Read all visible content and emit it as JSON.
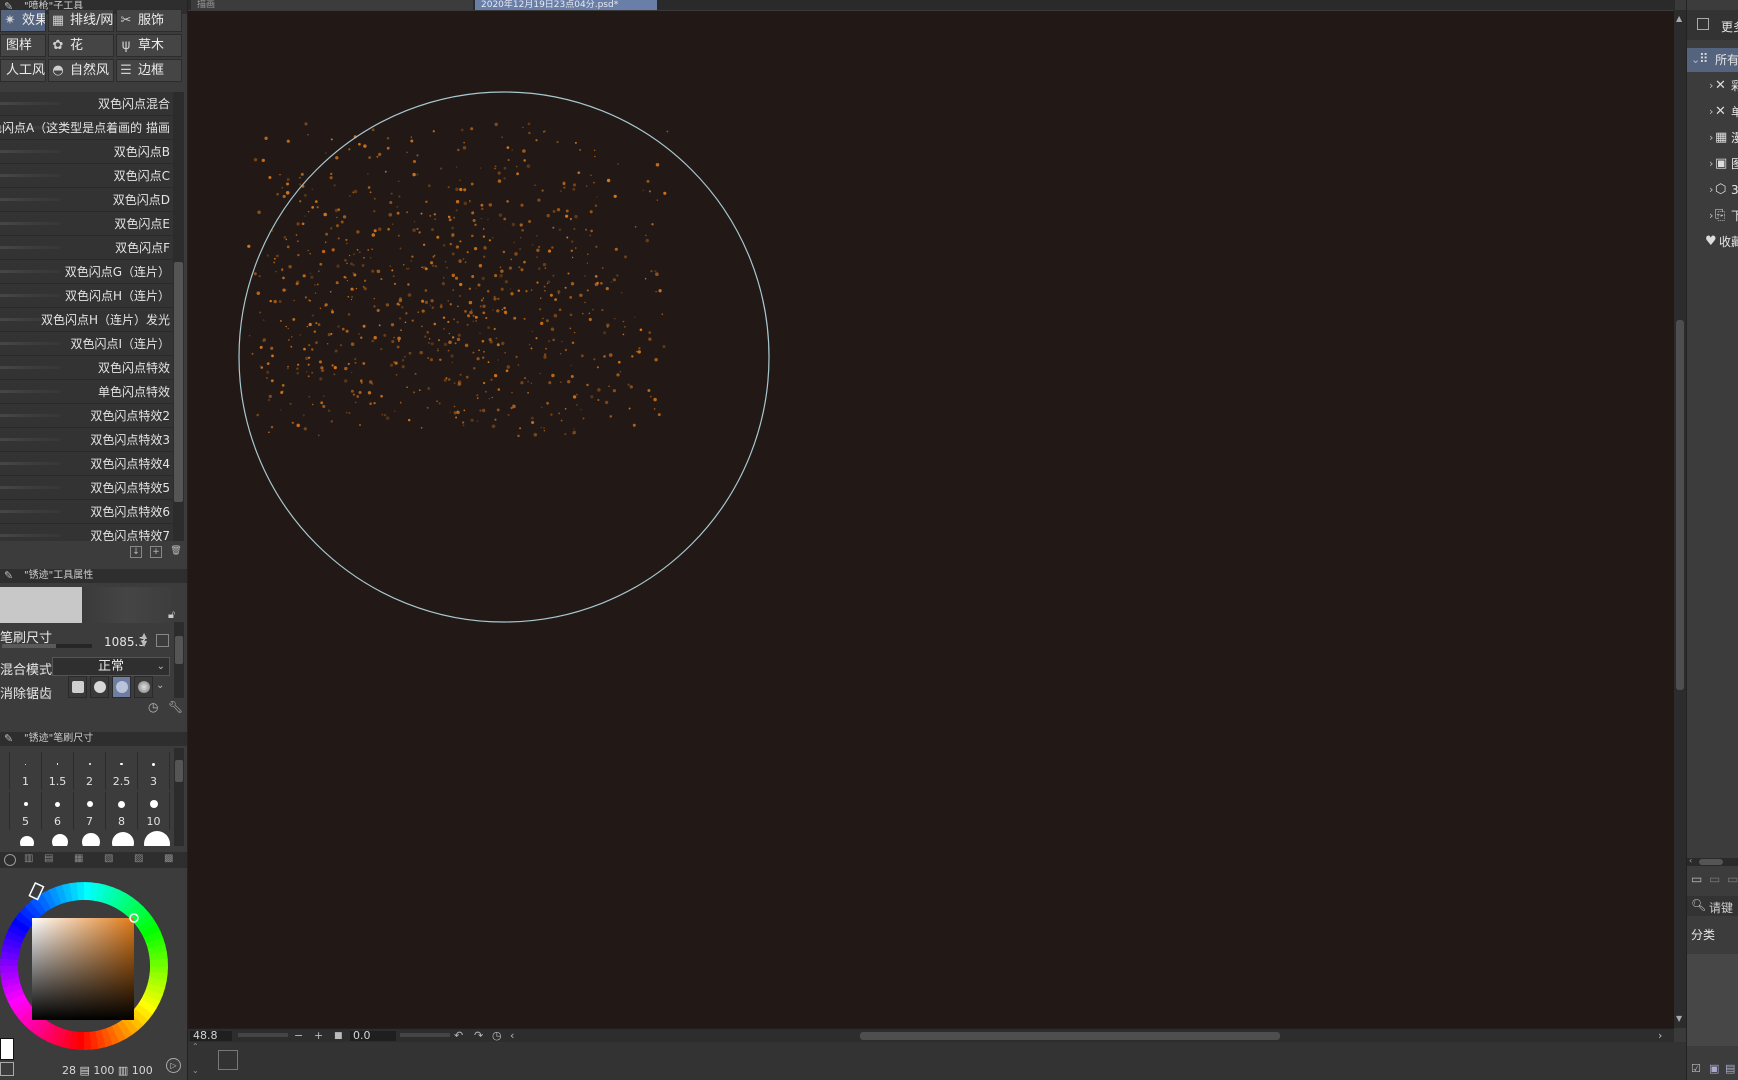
{
  "tabs": [
    {
      "label": "描画",
      "active": false
    },
    {
      "label": "2020年12月19日23点04分.psd*",
      "active": true
    }
  ],
  "left_panel": {
    "subtool_title": "\"喷枪\"子工具",
    "subtool_groups": [
      {
        "label": "效果/涂",
        "icon": "effect-icon",
        "active": true
      },
      {
        "label": "排线/网",
        "icon": "hatching-icon",
        "active": false
      },
      {
        "label": "服饰",
        "icon": "clothing-icon",
        "active": false
      },
      {
        "label": "图样",
        "icon": "pattern-icon",
        "active": false
      },
      {
        "label": "花",
        "icon": "flower-icon",
        "active": false
      },
      {
        "label": "草木",
        "icon": "grass-icon",
        "active": false
      },
      {
        "label": "人工风",
        "icon": "artificial-icon",
        "active": false
      },
      {
        "label": "自然风",
        "icon": "nature-icon",
        "active": false
      },
      {
        "label": "边框",
        "icon": "border-icon",
        "active": false
      }
    ],
    "brushes": [
      "双色闪点混合",
      "色闪点A（这类型是点着画的 描画",
      "双色闪点B",
      "双色闪点C",
      "双色闪点D",
      "双色闪点E",
      "双色闪点F",
      "双色闪点G（连片）",
      "双色闪点H（连片）",
      "双色闪点H（连片）发光",
      "双色闪点I（连片）",
      "双色闪点特效",
      "单色闪点特效",
      "双色闪点特效2",
      "双色闪点特效3",
      "双色闪点特效4",
      "双色闪点特效5",
      "双色闪点特效6",
      "双色闪点特效7"
    ],
    "tool_property_title": "\"锈迹\"工具属性",
    "properties": {
      "brush_size_label": "笔刷尺寸",
      "brush_size_value": "1085.3",
      "brush_size_level": 0.6,
      "blend_mode_label": "混合模式",
      "blend_mode_value": "正常",
      "antialias_label": "消除锯齿"
    },
    "brush_size_title": "\"锈迹\"笔刷尺寸",
    "sizes": [
      {
        "label": "7",
        "dot": 0
      },
      {
        "label": "1",
        "dot": 1
      },
      {
        "label": "1.5",
        "dot": 1.5
      },
      {
        "label": "2",
        "dot": 2
      },
      {
        "label": "2.5",
        "dot": 2.5
      },
      {
        "label": "3",
        "dot": 3
      },
      {
        "label": "",
        "dot": 0
      },
      {
        "label": "5",
        "dot": 4
      },
      {
        "label": "6",
        "dot": 5
      },
      {
        "label": "7",
        "dot": 6
      },
      {
        "label": "8",
        "dot": 7
      },
      {
        "label": "10",
        "dot": 8
      }
    ],
    "color_readout": "28 ▤ 100 ▥ 100",
    "colors": {
      "main": "#d98a3c"
    }
  },
  "canvas": {
    "zoom": "48.8",
    "angle": "0.0",
    "background": "#221917",
    "brush_cursor_color": "#a8c8d0",
    "spark_color": "#e07a18"
  },
  "right_panel": {
    "top_button": "更多",
    "material_items": [
      {
        "label": "所有",
        "icon": "grid-icon",
        "arrow": "⌄",
        "selected": true
      },
      {
        "label": "彩",
        "icon": "brush-cross-icon",
        "arrow": "›",
        "selected": false
      },
      {
        "label": "单",
        "icon": "brush-cross-icon",
        "arrow": "›",
        "selected": false
      },
      {
        "label": "漫",
        "icon": "layout-icon",
        "arrow": "›",
        "selected": false
      },
      {
        "label": "图",
        "icon": "image-icon",
        "arrow": "›",
        "selected": false
      },
      {
        "label": "3D",
        "icon": "cube-icon",
        "arrow": "›",
        "selected": false
      },
      {
        "label": "下",
        "icon": "download-icon",
        "arrow": "›",
        "selected": false
      },
      {
        "label": "收藏",
        "icon": "heart-icon",
        "arrow": "",
        "selected": false
      }
    ],
    "search_placeholder": "请键",
    "category_label": "分类"
  }
}
